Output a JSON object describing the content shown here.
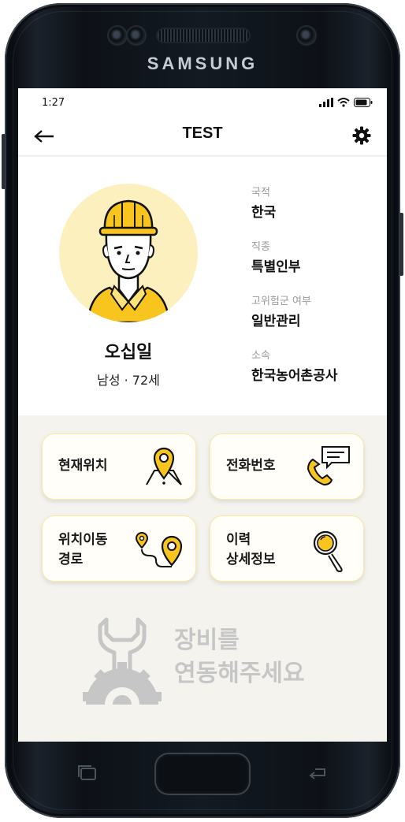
{
  "device": {
    "brand": "SAMSUNG"
  },
  "status_bar": {
    "time": "1:27"
  },
  "header": {
    "title": "TEST"
  },
  "profile": {
    "name": "오십일",
    "gender_age": "남성 · 72세",
    "info": [
      {
        "label": "국적",
        "value": "한국"
      },
      {
        "label": "직종",
        "value": "특별인부"
      },
      {
        "label": "고위험군 여부",
        "value": "일반관리"
      },
      {
        "label": "소속",
        "value": "한국농어촌공사"
      }
    ]
  },
  "actions": {
    "current_location": {
      "label": "현재위치",
      "icon": "map-pin-icon"
    },
    "phone_number": {
      "label": "전화번호",
      "icon": "phone-chat-icon"
    },
    "route_line1": "위치이동",
    "route_line2": "경로",
    "history_line1": "이력",
    "history_line2": "상세정보"
  },
  "device_prompt": {
    "line1": "장비를",
    "line2": "연동해주세요",
    "icon": "wrench-gear-icon"
  },
  "colors": {
    "accent": "#f7c51e",
    "avatar_bg": "#fdf0bf",
    "screen_bg": "#f5f3ee",
    "muted": "#c6c6c6"
  }
}
